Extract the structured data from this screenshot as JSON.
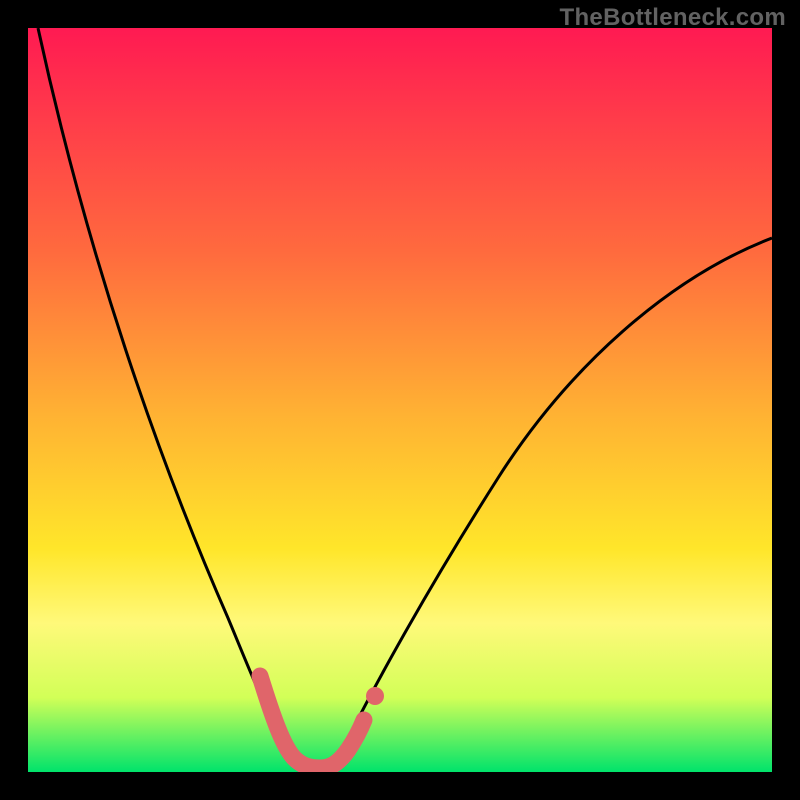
{
  "watermark": "TheBottleneck.com",
  "chart_data": {
    "type": "line",
    "title": "",
    "xlabel": "",
    "ylabel": "",
    "xlim": [
      0,
      100
    ],
    "ylim": [
      0,
      100
    ],
    "gradient_stops": [
      {
        "pos": 0,
        "color": "#ff1a52"
      },
      {
        "pos": 12,
        "color": "#ff3b4a"
      },
      {
        "pos": 30,
        "color": "#ff6a3e"
      },
      {
        "pos": 52,
        "color": "#ffb233"
      },
      {
        "pos": 70,
        "color": "#ffe62a"
      },
      {
        "pos": 80,
        "color": "#fff97a"
      },
      {
        "pos": 90,
        "color": "#d2ff57"
      },
      {
        "pos": 100,
        "color": "#00e36b"
      }
    ],
    "series": [
      {
        "name": "bottleneck-curve",
        "color": "#000000",
        "x": [
          1,
          5,
          10,
          15,
          20,
          25,
          28,
          30,
          32,
          34,
          36,
          38,
          40,
          45,
          50,
          55,
          60,
          65,
          70,
          75,
          80,
          85,
          90,
          95,
          100
        ],
        "values": [
          100,
          90,
          78,
          64,
          50,
          35,
          24,
          14,
          6,
          2,
          1,
          1,
          2,
          8,
          18,
          28,
          36,
          43,
          49,
          55,
          60,
          65,
          69,
          72,
          75
        ]
      },
      {
        "name": "bottom-highlight",
        "color": "#e0656a",
        "x": [
          28,
          30,
          32,
          34,
          36,
          38,
          40,
          42
        ],
        "values": [
          14,
          8,
          4,
          2,
          1.5,
          2,
          4,
          8
        ]
      }
    ]
  }
}
